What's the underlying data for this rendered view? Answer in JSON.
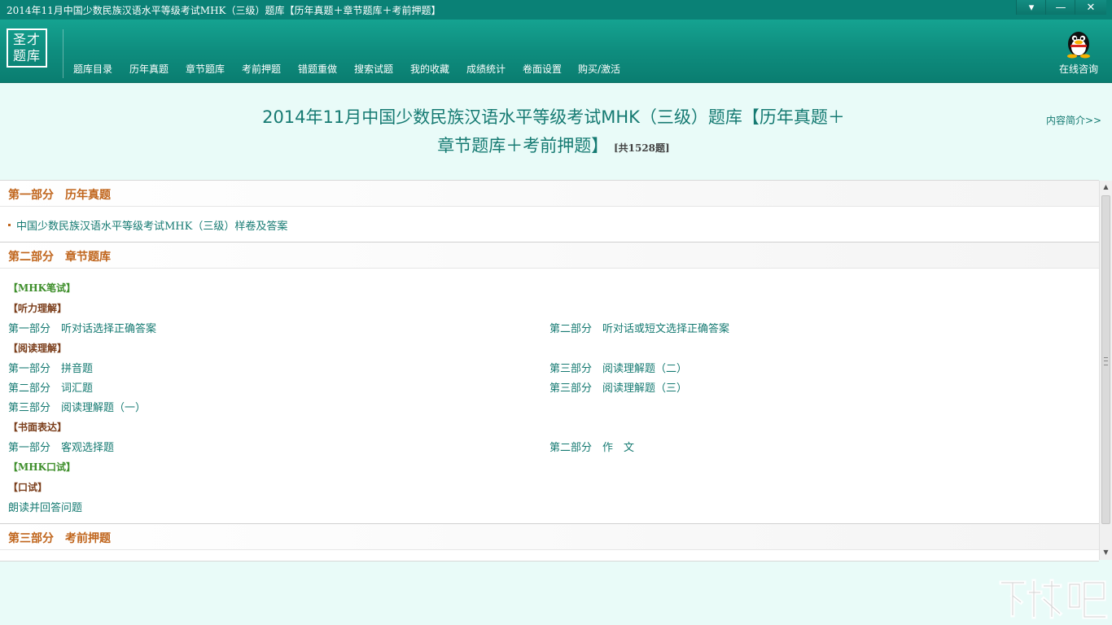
{
  "window": {
    "title": "2014年11月中国少数民族汉语水平等级考试MHK（三级）题库【历年真题＋章节题库＋考前押题】",
    "controls": {
      "menu": "▾",
      "minimize": "—",
      "close": "✕"
    }
  },
  "header": {
    "logo_line1": "圣才",
    "logo_line2": "题库",
    "nav": [
      "题库目录",
      "历年真题",
      "章节题库",
      "考前押题",
      "错题重做",
      "搜索试题",
      "我的收藏",
      "成绩统计",
      "卷面设置",
      "购买/激活"
    ],
    "consult_label": "在线咨询",
    "consult_icon": "qq-penguin-icon"
  },
  "page": {
    "title_line1": "2014年11月中国少数民族汉语水平等级考试MHK（三级）题库【历年真题＋",
    "title_line2": "章节题库＋考前押题】",
    "count": "[共1528题]",
    "intro_link": "内容简介>>"
  },
  "sections": {
    "part1": {
      "title": "第一部分　历年真题",
      "items": [
        "中国少数民族汉语水平等级考试MHK（三级）样卷及答案"
      ]
    },
    "part2": {
      "title": "第二部分　章节题库",
      "mhk_written": "【MHK笔试】",
      "listening": {
        "label": "【听力理解】",
        "left": [
          "第一部分　听对话选择正确答案"
        ],
        "right": [
          "第二部分　听对话或短文选择正确答案"
        ]
      },
      "reading": {
        "label": "【阅读理解】",
        "left": [
          "第一部分　拼音题",
          "第二部分　词汇题",
          "第三部分　阅读理解题（一）"
        ],
        "right": [
          "第三部分　阅读理解题（二）",
          "第三部分　阅读理解题（三）"
        ]
      },
      "writing": {
        "label": "【书面表达】",
        "left": [
          "第一部分　客观选择题"
        ],
        "right": [
          "第二部分　作　文"
        ]
      },
      "mhk_oral": "【MHK口试】",
      "oral": {
        "label": "【口试】",
        "left": [
          "朗读并回答问题"
        ]
      }
    },
    "part3": {
      "title": "第三部分　考前押题"
    }
  },
  "watermark": "下载吧"
}
